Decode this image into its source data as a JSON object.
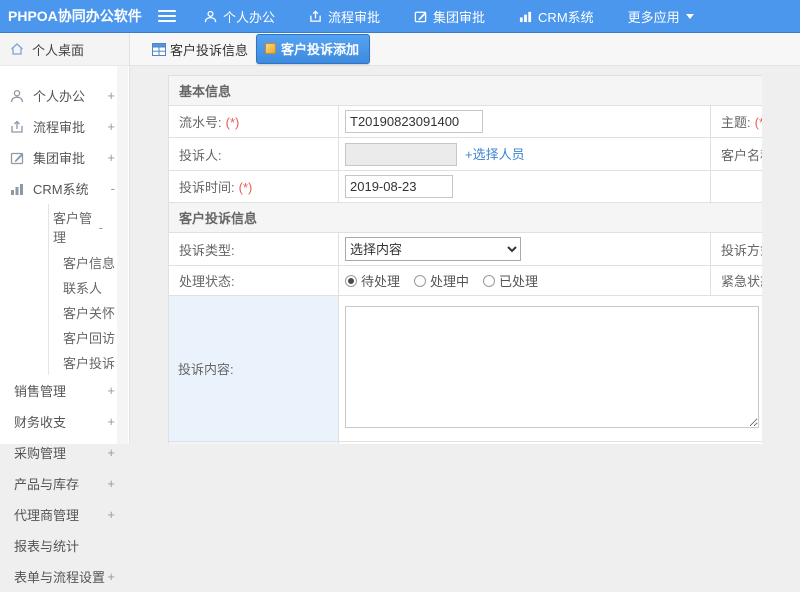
{
  "app": {
    "logo_text": "PHPOA协同办公软件"
  },
  "header": {
    "nav": [
      {
        "label": "个人办公",
        "icon": "user-icon"
      },
      {
        "label": "流程审批",
        "icon": "workflow-icon"
      },
      {
        "label": "集团审批",
        "icon": "edit-icon"
      },
      {
        "label": "CRM系统",
        "icon": "bar-chart-icon"
      },
      {
        "label": "更多应用",
        "icon": "caret-down-icon"
      }
    ]
  },
  "sidebar": {
    "active": {
      "label": "个人桌面",
      "icon": "home-icon"
    },
    "items": [
      {
        "label": "个人办公",
        "sign": "+",
        "icon": "user-icon"
      },
      {
        "label": "流程审批",
        "sign": "+",
        "icon": "workflow-icon"
      },
      {
        "label": "集团审批",
        "sign": "+",
        "icon": "edit-icon"
      },
      {
        "label": "CRM系统",
        "sign": "-",
        "icon": "bar-chart-icon"
      }
    ],
    "customer_group": {
      "label": "客户管理",
      "sign": "-",
      "children": [
        {
          "label": "客户信息"
        },
        {
          "label": "联系人"
        },
        {
          "label": "客户关怀"
        },
        {
          "label": "客户回访"
        },
        {
          "label": "客户投诉"
        }
      ]
    },
    "items_lower": [
      {
        "label": "销售管理",
        "sign": "+"
      },
      {
        "label": "财务收支",
        "sign": "+"
      },
      {
        "label": "采购管理",
        "sign": "+"
      },
      {
        "label": "产品与库存",
        "sign": "+"
      },
      {
        "label": "代理商管理",
        "sign": "+"
      },
      {
        "label": "报表与统计",
        "sign": ""
      },
      {
        "label": "表单与流程设置",
        "sign": "+"
      }
    ]
  },
  "tabs": {
    "info_tab": "客户投诉信息",
    "add_tab": "客户投诉添加"
  },
  "form": {
    "sections": {
      "basic": "基本信息",
      "complaint": "客户投诉信息"
    },
    "required_mark": "(*)",
    "serial": {
      "label": "流水号:",
      "value": "T20190823091400"
    },
    "subject": {
      "label": "主题:"
    },
    "complainant": {
      "label": "投诉人:",
      "value": "",
      "picker_link": "+选择人员"
    },
    "customer": {
      "label": "客户名称:"
    },
    "time": {
      "label": "投诉时间:",
      "value": "2019-08-23"
    },
    "type": {
      "label": "投诉类型:",
      "value": "选择内容"
    },
    "method": {
      "label": "投诉方式:"
    },
    "status": {
      "label": "处理状态:",
      "options": [
        "待处理",
        "处理中",
        "已处理"
      ],
      "selected": "待处理"
    },
    "urgency": {
      "label": "紧急状态:"
    },
    "content": {
      "label": "投诉内容:",
      "value": ""
    }
  },
  "colors": {
    "header_blue": "#4b97ee",
    "button_blue": "#3e8ade",
    "link_blue": "#3d84d0",
    "required_red": "#ee5a55",
    "highlight_cell": "#eaf3fb"
  }
}
